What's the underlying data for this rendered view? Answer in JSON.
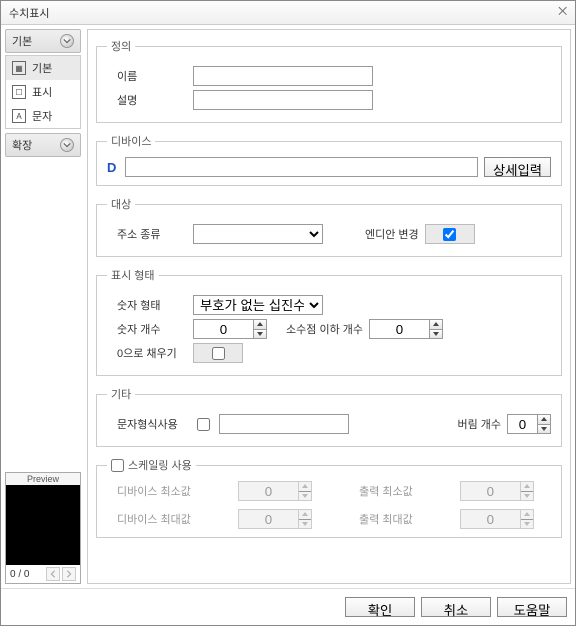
{
  "window": {
    "title": "수치표시"
  },
  "sidebar": {
    "cat_basic": "기본",
    "cat_extend": "확장",
    "items": [
      {
        "label": "기본"
      },
      {
        "label": "표시"
      },
      {
        "label": "문자"
      }
    ]
  },
  "preview": {
    "label": "Preview",
    "footer": "0 / 0"
  },
  "definition": {
    "legend": "정의",
    "name_label": "이름",
    "name_value": "",
    "desc_label": "설명",
    "desc_value": ""
  },
  "device": {
    "legend": "디바이스",
    "prefix": "D",
    "value": "",
    "detail_btn": "상세입력"
  },
  "target": {
    "legend": "대상",
    "addr_label": "주소 종류",
    "addr_value": "",
    "endian_label": "엔디안 변경",
    "endian_checked": true
  },
  "format": {
    "legend": "표시 형태",
    "numtype_label": "숫자 형태",
    "numtype_value": "부호가 없는 십진수",
    "digits_label": "숫자 개수",
    "digits_value": "0",
    "decimals_label": "소수점 이하 개수",
    "decimals_value": "0",
    "zerofill_label": "0으로 채우기",
    "zerofill_checked": false
  },
  "etc": {
    "legend": "기타",
    "usefmt_label": "문자형식사용",
    "usefmt_checked": false,
    "fmt_value": "",
    "trim_label": "버림 개수",
    "trim_value": "0"
  },
  "scaling": {
    "enable_label": "스케일링 사용",
    "enable_checked": false,
    "dev_min_label": "디바이스 최소값",
    "dev_min_value": "0",
    "dev_max_label": "디바이스 최대값",
    "dev_max_value": "0",
    "out_min_label": "출력 최소값",
    "out_min_value": "0",
    "out_max_label": "출력 최대값",
    "out_max_value": "0"
  },
  "buttons": {
    "ok": "확인",
    "cancel": "취소",
    "help": "도움말"
  }
}
